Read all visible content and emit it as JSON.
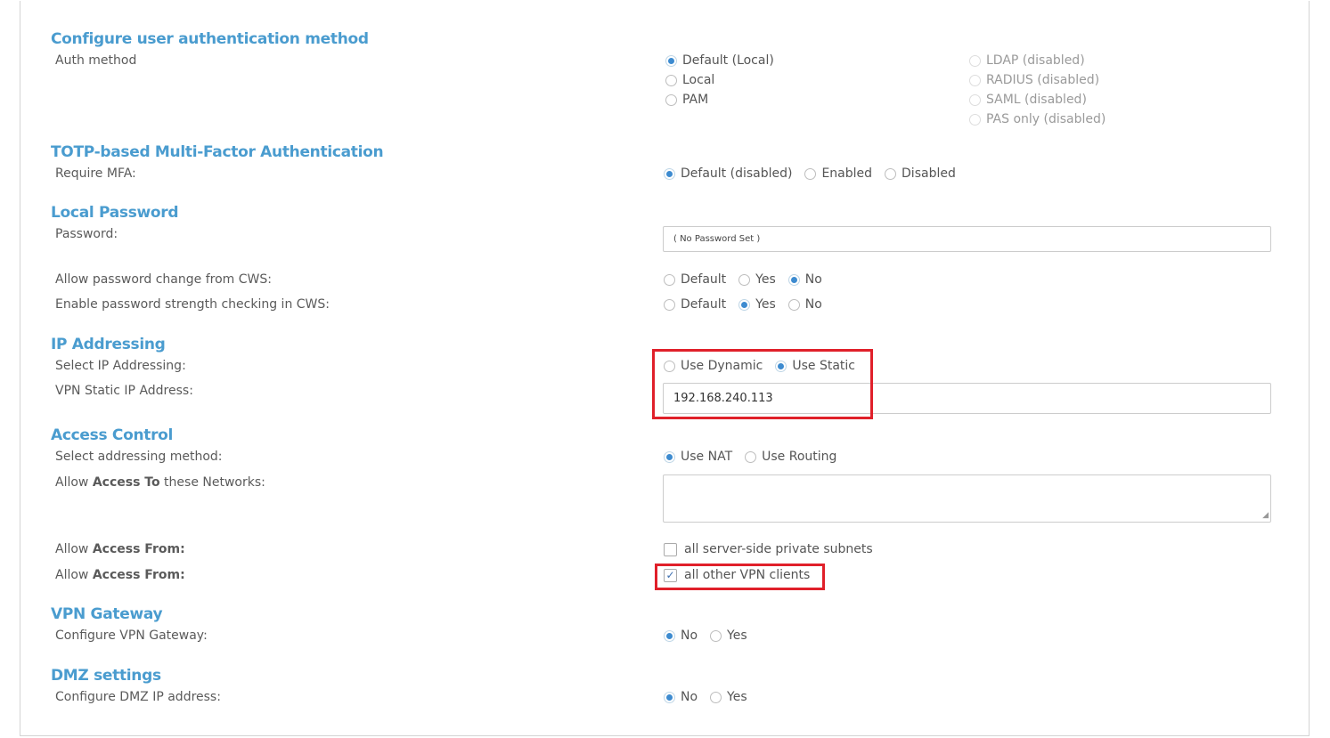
{
  "auth": {
    "title": "Configure user authentication method",
    "label": "Auth method",
    "options_left": [
      {
        "label": "Default (Local)",
        "checked": true
      },
      {
        "label": "Local",
        "checked": false
      },
      {
        "label": "PAM",
        "checked": false
      }
    ],
    "options_right": [
      {
        "label": "LDAP (disabled)"
      },
      {
        "label": "RADIUS (disabled)"
      },
      {
        "label": "SAML (disabled)"
      },
      {
        "label": "PAS only (disabled)"
      }
    ]
  },
  "mfa": {
    "title": "TOTP-based Multi-Factor Authentication",
    "label": "Require MFA:",
    "opt_default": "Default (disabled)",
    "opt_enabled": "Enabled",
    "opt_disabled": "Disabled",
    "selected": "Default (disabled)"
  },
  "password": {
    "title": "Local Password",
    "label": "Password:",
    "value": "( No Password Set )",
    "change_label": "Allow password change from CWS:",
    "change_opts": [
      "Default",
      "Yes",
      "No"
    ],
    "change_selected": "No",
    "strength_label": "Enable password strength checking in CWS:",
    "strength_opts": [
      "Default",
      "Yes",
      "No"
    ],
    "strength_selected": "Yes"
  },
  "ip": {
    "title": "IP Addressing",
    "select_label": "Select IP Addressing:",
    "opt_dynamic": "Use Dynamic",
    "opt_static": "Use Static",
    "selected": "Use Static",
    "static_label": "VPN Static IP Address:",
    "static_value": "192.168.240.113"
  },
  "access": {
    "title": "Access Control",
    "method_label": "Select addressing method:",
    "opt_nat": "Use NAT",
    "opt_routing": "Use Routing",
    "selected": "Use NAT",
    "networks_label_pre": "Allow ",
    "networks_label_bold": "Access To",
    "networks_label_post": " these Networks:",
    "networks_value": "",
    "from_label_pre": "Allow ",
    "from_label_bold": "Access From:",
    "subnets_label": "all server-side private subnets",
    "subnets_checked": false,
    "vpn_clients_label": "all other VPN clients",
    "vpn_clients_checked": true
  },
  "gateway": {
    "title": "VPN Gateway",
    "label": "Configure VPN Gateway:",
    "opt_no": "No",
    "opt_yes": "Yes",
    "selected": "No"
  },
  "dmz": {
    "title": "DMZ settings",
    "label": "Configure DMZ IP address:",
    "opt_no": "No",
    "opt_yes": "Yes",
    "selected": "No"
  },
  "colors": {
    "section_title": "#4a9ccf",
    "radio_selected": "#3d8bd0",
    "highlight": "#e0202a"
  },
  "icons": {
    "checkmark": "✓",
    "resize_handle": "◢"
  }
}
